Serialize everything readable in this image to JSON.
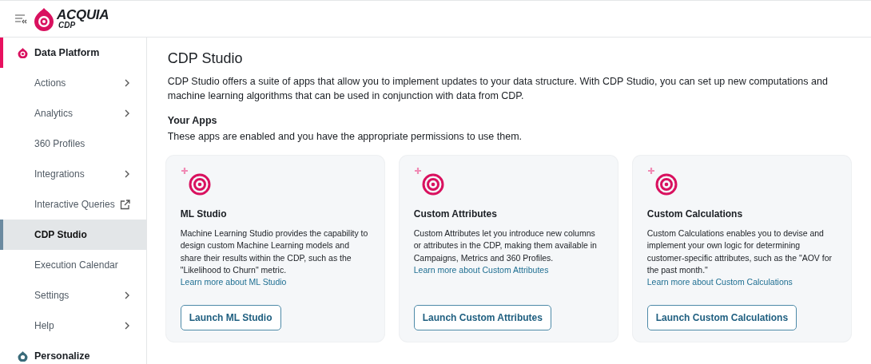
{
  "header": {
    "logo": {
      "name": "ACQUIA",
      "sub": "CDP"
    }
  },
  "sidebar": {
    "items": [
      {
        "kind": "section",
        "label": "Data Platform",
        "active": true,
        "selected": false
      },
      {
        "kind": "item",
        "label": "Actions",
        "chevron": true,
        "external": false,
        "selected": false
      },
      {
        "kind": "item",
        "label": "Analytics",
        "chevron": true,
        "external": false,
        "selected": false
      },
      {
        "kind": "item",
        "label": "360 Profiles",
        "chevron": false,
        "external": false,
        "selected": false
      },
      {
        "kind": "item",
        "label": "Integrations",
        "chevron": true,
        "external": false,
        "selected": false
      },
      {
        "kind": "item",
        "label": "Interactive Queries",
        "chevron": false,
        "external": true,
        "selected": false
      },
      {
        "kind": "item",
        "label": "CDP Studio",
        "chevron": false,
        "external": false,
        "selected": true
      },
      {
        "kind": "item",
        "label": "Execution Calendar",
        "chevron": false,
        "external": false,
        "selected": false
      },
      {
        "kind": "item",
        "label": "Settings",
        "chevron": true,
        "external": false,
        "selected": false
      },
      {
        "kind": "item",
        "label": "Help",
        "chevron": true,
        "external": false,
        "selected": false
      },
      {
        "kind": "section",
        "label": "Personalize",
        "active": false,
        "selected": false
      }
    ]
  },
  "page": {
    "title": "CDP Studio",
    "description": "CDP Studio offers a suite of apps that allow you to implement updates to your data structure. With CDP Studio, you can set up new computations and machine learning algorithms that can be used in conjunction with data from CDP.",
    "subtitle": "Your Apps",
    "subdescription": "These apps are enabled and you have the appropriate permissions to use them."
  },
  "apps": [
    {
      "title": "ML Studio",
      "text": "Machine Learning Studio provides the capability to design custom Machine Learning models and share their results within the CDP, such as the \"Likelihood to Churn\" metric.",
      "link": "Learn more about ML Studio",
      "button": "Launch ML Studio"
    },
    {
      "title": "Custom Attributes",
      "text": "Custom Attributes let you introduce new columns or attributes in the CDP, making them available in Campaigns, Metrics and 360 Profiles.",
      "link": "Learn more about Custom Attributes",
      "button": "Launch Custom Attributes"
    },
    {
      "title": "Custom Calculations",
      "text": "Custom Calculations enables you to devise and implement your own logic for determining customer-specific attributes, such as the \"AOV for the past month.\"",
      "link": "Learn more about Custom Calculations",
      "button": "Launch Custom Calculations"
    }
  ]
}
